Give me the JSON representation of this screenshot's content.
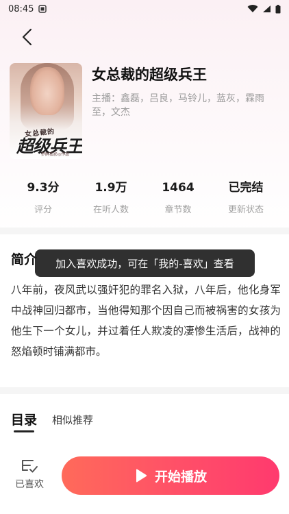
{
  "status_bar": {
    "time": "08:45",
    "icons": [
      "notification-icon",
      "wifi-icon",
      "signal-icon",
      "battery-icon"
    ]
  },
  "book": {
    "title": "女总裁的超级兵王",
    "cast": "主播：鑫磊，吕良，马铃儿，蓝灰，霖雨至，文杰",
    "cover": {
      "subtitle": "女总裁的",
      "title": "超级兵王",
      "author": "梦醉孤影◎作品"
    }
  },
  "stats": [
    {
      "value": "9.3分",
      "label": "评分"
    },
    {
      "value": "1.9万",
      "label": "在听人数"
    },
    {
      "value": "1464",
      "label": "章节数"
    },
    {
      "value": "已完结",
      "label": "更新状态"
    }
  ],
  "intro": {
    "heading": "简介",
    "text": "八年前，夜风武以强奸犯的罪名入狱，八年后，他化身军中战神回归都市，当他得知那个因自己而被祸害的女孩为他生下一个女儿，并过着任人欺凌的凄惨生活后，战神的怒焰顿时铺满都市。"
  },
  "toast": {
    "message": "加入喜欢成功，可在「我的-喜欢」查看"
  },
  "tabs": {
    "catalog": "目录",
    "similar": "相似推荐"
  },
  "bottom": {
    "fav_label": "已喜欢",
    "play_label": "开始播放"
  },
  "colors": {
    "accent_start": "#ff6a5a",
    "accent_end": "#ff3a6e",
    "toast_bg": "#1e1e1e"
  }
}
